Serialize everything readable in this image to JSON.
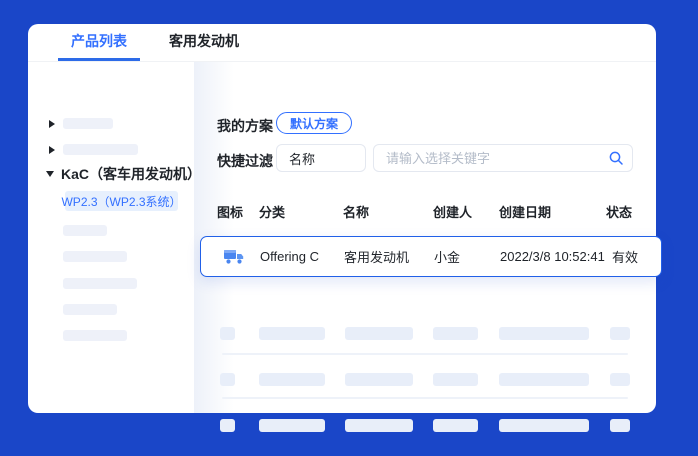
{
  "window": {
    "tabs": [
      "产品列表",
      "客用发动机"
    ]
  },
  "sidebar": {
    "expanded_item": "KaC（客车用发动机）",
    "selected_subitem": "WP2.3（WP2.3系统）"
  },
  "plan": {
    "label": "我的方案",
    "default_button": "默认方案"
  },
  "filter": {
    "label": "快捷过滤",
    "field": "名称",
    "search_placeholder": "请输入选择关键字",
    "search_icon": "search-icon"
  },
  "table": {
    "headers": [
      "图标",
      "分类",
      "名称",
      "创建人",
      "创建日期",
      "状态"
    ],
    "highlighted_row": {
      "icon": "truck-icon",
      "category": "Offering C",
      "name": "客用发动机",
      "creator": "小金",
      "created_date": "2022/3/8 10:52:41",
      "status": "有效"
    }
  },
  "colors": {
    "background": "#1a46c8",
    "accent": "#3370ff",
    "tab_underline": "#2d6be8",
    "row_border": "#2160e8",
    "selected_subitem_bg": "#e7f0fd",
    "skeleton_sidebar": "#eef1f9",
    "skeleton_table": "#e8eef9",
    "truck_icon": "#4a86f0",
    "text_dark": "#1f2329",
    "placeholder_text": "#b4bcc9"
  }
}
